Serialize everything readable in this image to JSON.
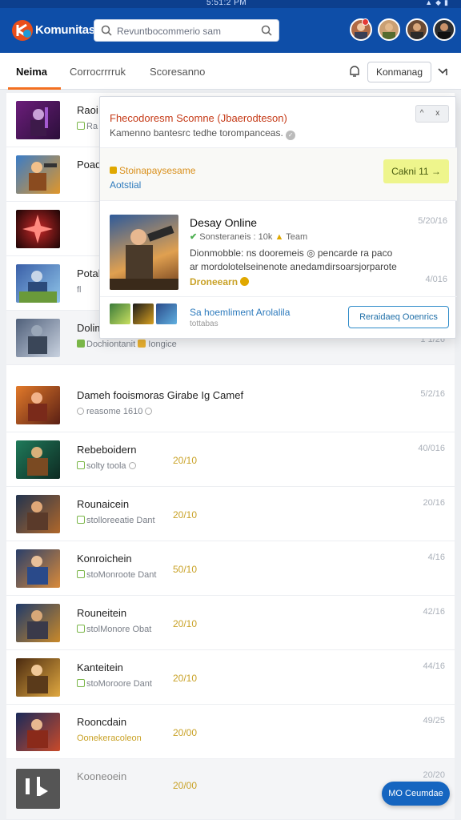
{
  "status_bar": {
    "time": "5:51:2 PM",
    "icons": [
      "signal-icon",
      "wifi-icon",
      "battery-icon"
    ]
  },
  "header": {
    "brand": "Komunitas",
    "search": {
      "placeholder": "Revuntbocommerio sam"
    },
    "colors": {
      "bar": "#0e4ea8",
      "accent": "#f37021"
    }
  },
  "tabs": {
    "items": [
      {
        "label": "Neima",
        "active": true
      },
      {
        "label": "Corrocrrrruk"
      },
      {
        "label": "Scoresanno"
      }
    ],
    "manage_label": "Konmanag"
  },
  "popup": {
    "title": "Fhecodoresm Scomne (Jbaerodteson)",
    "subtitle": "Kamenno bantesrc tedhe torompanceas.",
    "collapse_label": "^ x",
    "offer": {
      "label": "Stoinapaysesame",
      "sub": "Aotstial",
      "button": "Cakni 11 →"
    },
    "game": {
      "title": "Desay Online",
      "meta_check": "✔",
      "meta_text": "Sonsteraneis : 10k",
      "meta_team": "Team",
      "desc_line1": "Dionmobble: ns dooremeis ◎ pencarde ra paco",
      "desc_line2": "ar mordolotelseinenote anedamdirsoarsjorparote",
      "tag": "Droneearn",
      "date_top": "5/20/16",
      "date_bottom": "4/016"
    },
    "footer": {
      "title": "Sa hoemliment Arolalila",
      "sub": "tottabas",
      "button": "Reraidaeq Ooenrics"
    }
  },
  "rows": [
    {
      "title": "Raoi",
      "meta": "Ra",
      "score": "",
      "date": ""
    },
    {
      "title": "Poad",
      "meta": "",
      "score": "",
      "date": ""
    },
    {
      "title": "",
      "meta": "",
      "score": "",
      "date": ""
    },
    {
      "title": "Potal",
      "meta": "fl",
      "score": "",
      "date": ""
    },
    {
      "title": "Dolim",
      "meta": "Dochiontanit",
      "meta2": "Iongice",
      "score": "",
      "date": "1 1/26"
    },
    {
      "title": "Dameh fooismoras Girabe Ig Camef",
      "meta": "reasome 1610",
      "score": "",
      "date": "5/2/16"
    },
    {
      "title": "Rebeboidern",
      "meta": "solty toola",
      "score": "20/10",
      "date": "40/016"
    },
    {
      "title": "Rounaicein",
      "meta": "stolloreeatie Dant",
      "score": "20/10",
      "date": "20/16"
    },
    {
      "title": "Konroichein",
      "meta": "stoMonroote Dant",
      "score": "50/10",
      "date": "4/16"
    },
    {
      "title": "Rouneitein",
      "meta": "stolMonore Obat",
      "score": "20/10",
      "date": "42/16"
    },
    {
      "title": "Kanteitein",
      "meta": "stoMoroore Dant",
      "score": "20/10",
      "date": "44/16"
    },
    {
      "title": "Rooncdain",
      "meta": "Oonekeracoleon",
      "score": "20/00",
      "date": "49/25"
    },
    {
      "title": "Kooneoein",
      "meta": "",
      "score": "20/00",
      "date": "20/20"
    }
  ],
  "fab_label": "MO Ceumdae"
}
